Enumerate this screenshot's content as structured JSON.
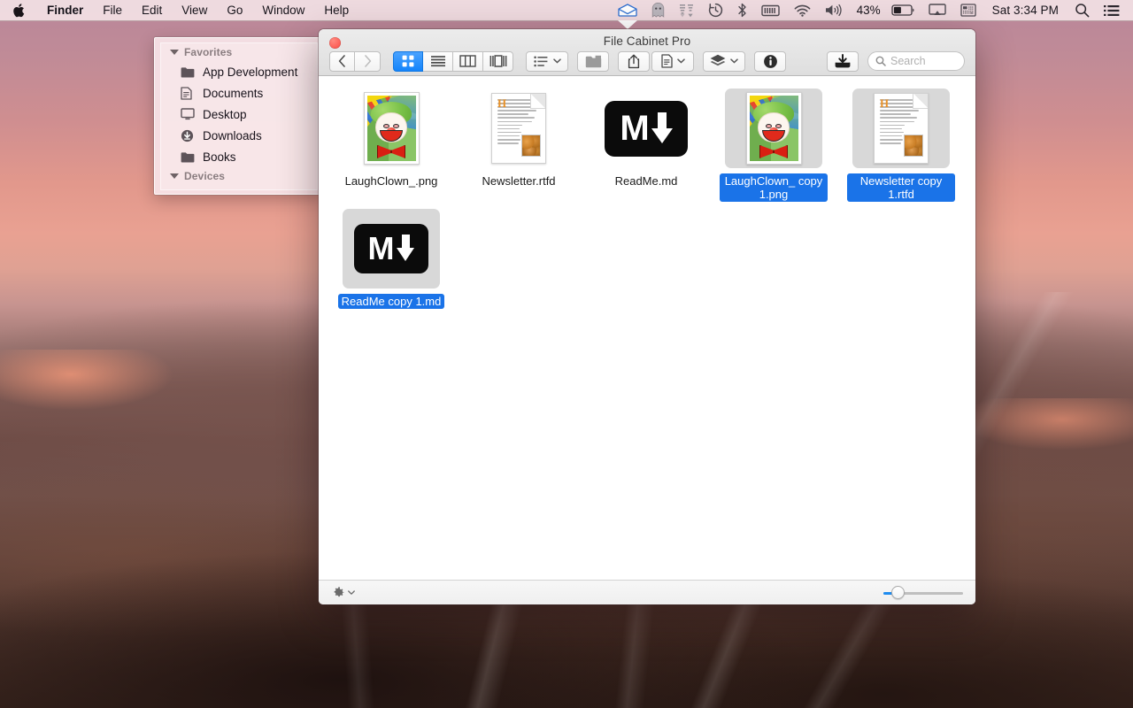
{
  "menubar": {
    "apple_icon": "apple-logo-icon",
    "items": [
      {
        "label": "Finder",
        "bold": true
      },
      {
        "label": "File",
        "bold": false
      },
      {
        "label": "Edit",
        "bold": false
      },
      {
        "label": "View",
        "bold": false
      },
      {
        "label": "Go",
        "bold": false
      },
      {
        "label": "Window",
        "bold": false
      },
      {
        "label": "Help",
        "bold": false
      }
    ],
    "status": {
      "mail_icon": "open-envelope-icon",
      "ghost_icon": "ghost-icon",
      "transfer_icon": "transfer-arrows-icon",
      "timemachine_icon": "time-machine-clock-icon",
      "bluetooth_icon": "bluetooth-icon",
      "battery_bar_icon": "battery-meter-icon",
      "wifi_icon": "wifi-icon",
      "volume_icon": "volume-icon",
      "battery_percent": "43%",
      "battery_icon": "battery-icon",
      "airplay_icon": "airplay-icon",
      "inputsource_icon": "input-source-icon",
      "clock": "Sat 3:34 PM",
      "spotlight_icon": "search-icon",
      "notification_icon": "notification-center-icon"
    }
  },
  "sidebar": {
    "sections": [
      {
        "title": "Favorites",
        "items": [
          {
            "label": "App Development",
            "icon": "folder-icon"
          },
          {
            "label": "Documents",
            "icon": "document-icon"
          },
          {
            "label": "Desktop",
            "icon": "display-icon"
          },
          {
            "label": "Downloads",
            "icon": "downloads-icon"
          },
          {
            "label": "Books",
            "icon": "folder-icon"
          }
        ]
      },
      {
        "title": "Devices",
        "items": []
      }
    ]
  },
  "window": {
    "title": "File Cabinet Pro",
    "close_label": "Close",
    "toolbar": {
      "back_icon": "chevron-left-icon",
      "forward_icon": "chevron-right-icon",
      "view_icon_label": "icon-view-icon",
      "view_list_label": "list-view-icon",
      "view_column_label": "column-view-icon",
      "view_gallery_label": "gallery-view-icon",
      "arrange_icon": "arrange-by-icon",
      "newfolder_icon": "new-folder-icon",
      "share_icon": "share-icon",
      "action_icon": "document-action-icon",
      "layers_icon": "layers-icon",
      "info_icon": "info-icon",
      "download_icon": "download-icon",
      "search_placeholder": "Search",
      "search_value": ""
    },
    "statusbar": {
      "gear_icon": "gear-icon",
      "zoom_value": 13,
      "zoom_min": 0,
      "zoom_max": 100
    }
  },
  "files": [
    {
      "name": "LaughClown_.png",
      "kind": "image",
      "selected": false
    },
    {
      "name": "Newsletter.rtfd",
      "kind": "rtfd",
      "selected": false
    },
    {
      "name": "ReadMe.md",
      "kind": "markdown",
      "selected": false
    },
    {
      "name": "LaughClown_ copy 1.png",
      "kind": "image",
      "selected": true
    },
    {
      "name": "Newsletter copy 1.rtfd",
      "kind": "rtfd",
      "selected": true
    },
    {
      "name": "ReadMe copy 1.md",
      "kind": "markdown",
      "selected": true
    }
  ],
  "colors": {
    "selection_blue": "#1a73e8",
    "active_view_blue": "#1384fb",
    "close_red": "#fd625a",
    "slider_blue": "#1e8cf0"
  }
}
